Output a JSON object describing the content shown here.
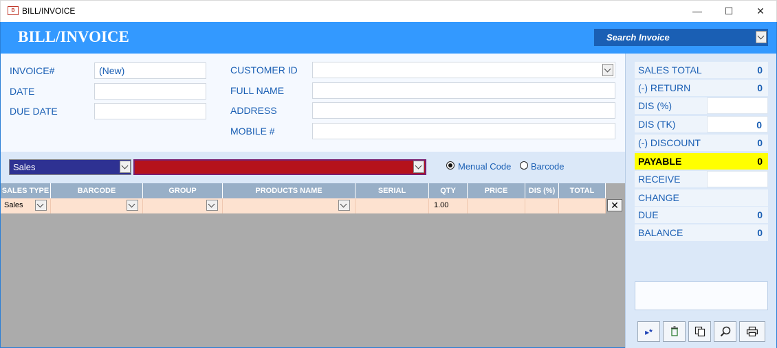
{
  "window": {
    "title": "BILL/INVOICE",
    "minimize_glyph": "—",
    "maximize_glyph": "☐",
    "close_glyph": "✕"
  },
  "header": {
    "title": "BILL/INVOICE",
    "search_placeholder": "Search Invoice"
  },
  "form": {
    "invoice_label": "INVOICE#",
    "invoice_value": "(New)",
    "date_label": "DATE",
    "date_value": "",
    "due_date_label": "DUE DATE",
    "due_date_value": "",
    "customer_id_label": "CUSTOMER ID",
    "customer_id_value": "",
    "full_name_label": "FULL NAME",
    "full_name_value": "",
    "address_label": "ADDRESS",
    "address_value": "",
    "mobile_label": "MOBILE #",
    "mobile_value": ""
  },
  "selector": {
    "sales_type": "Sales",
    "product": "",
    "code_mode_selected": "Menual Code",
    "manual_code_label": "Menual Code",
    "barcode_label": "Barcode"
  },
  "grid": {
    "columns": [
      "SALES TYPE",
      "BARCODE",
      "GROUP",
      "PRODUCTS NAME",
      "SERIAL",
      "QTY",
      "PRICE",
      "DIS (%)",
      "TOTAL"
    ],
    "rows": [
      {
        "sales_type": "Sales",
        "barcode": "",
        "group": "",
        "product": "",
        "serial": "",
        "qty": "1.00",
        "price": "",
        "dis": "",
        "total": ""
      }
    ],
    "delete_glyph": "✕"
  },
  "summary": {
    "sales_total_label": "SALES TOTAL",
    "sales_total": "0",
    "return_label": "(-) RETURN",
    "return": "0",
    "dis_pct_label": "DIS (%)",
    "dis_pct": "",
    "dis_tk_label": "DIS (TK)",
    "dis_tk": "0",
    "discount_label": "(-) DISCOUNT",
    "discount": "0",
    "payable_label": "PAYABLE",
    "payable": "0",
    "receive_label": "RECEIVE",
    "receive": "",
    "change_label": "CHANGE",
    "change": "",
    "due_label": "DUE",
    "due": "0",
    "balance_label": "BALANCE",
    "balance": "0"
  },
  "toolbar": {
    "new_icon": "new-record-icon",
    "delete_icon": "recycle-bin-icon",
    "copy_icon": "copy-icon",
    "search_icon": "search-icon",
    "print_icon": "printer-icon"
  },
  "colors": {
    "header_blue": "#3399ff",
    "search_bg": "#1a5fb4",
    "label_blue": "#1a5fb4",
    "sales_dd": "#2e3192",
    "product_dd": "#b5121b",
    "payable_highlight": "#ffff00",
    "grid_header": "#98afc7",
    "grid_row": "#fde2d0",
    "grid_empty": "#ababab"
  }
}
